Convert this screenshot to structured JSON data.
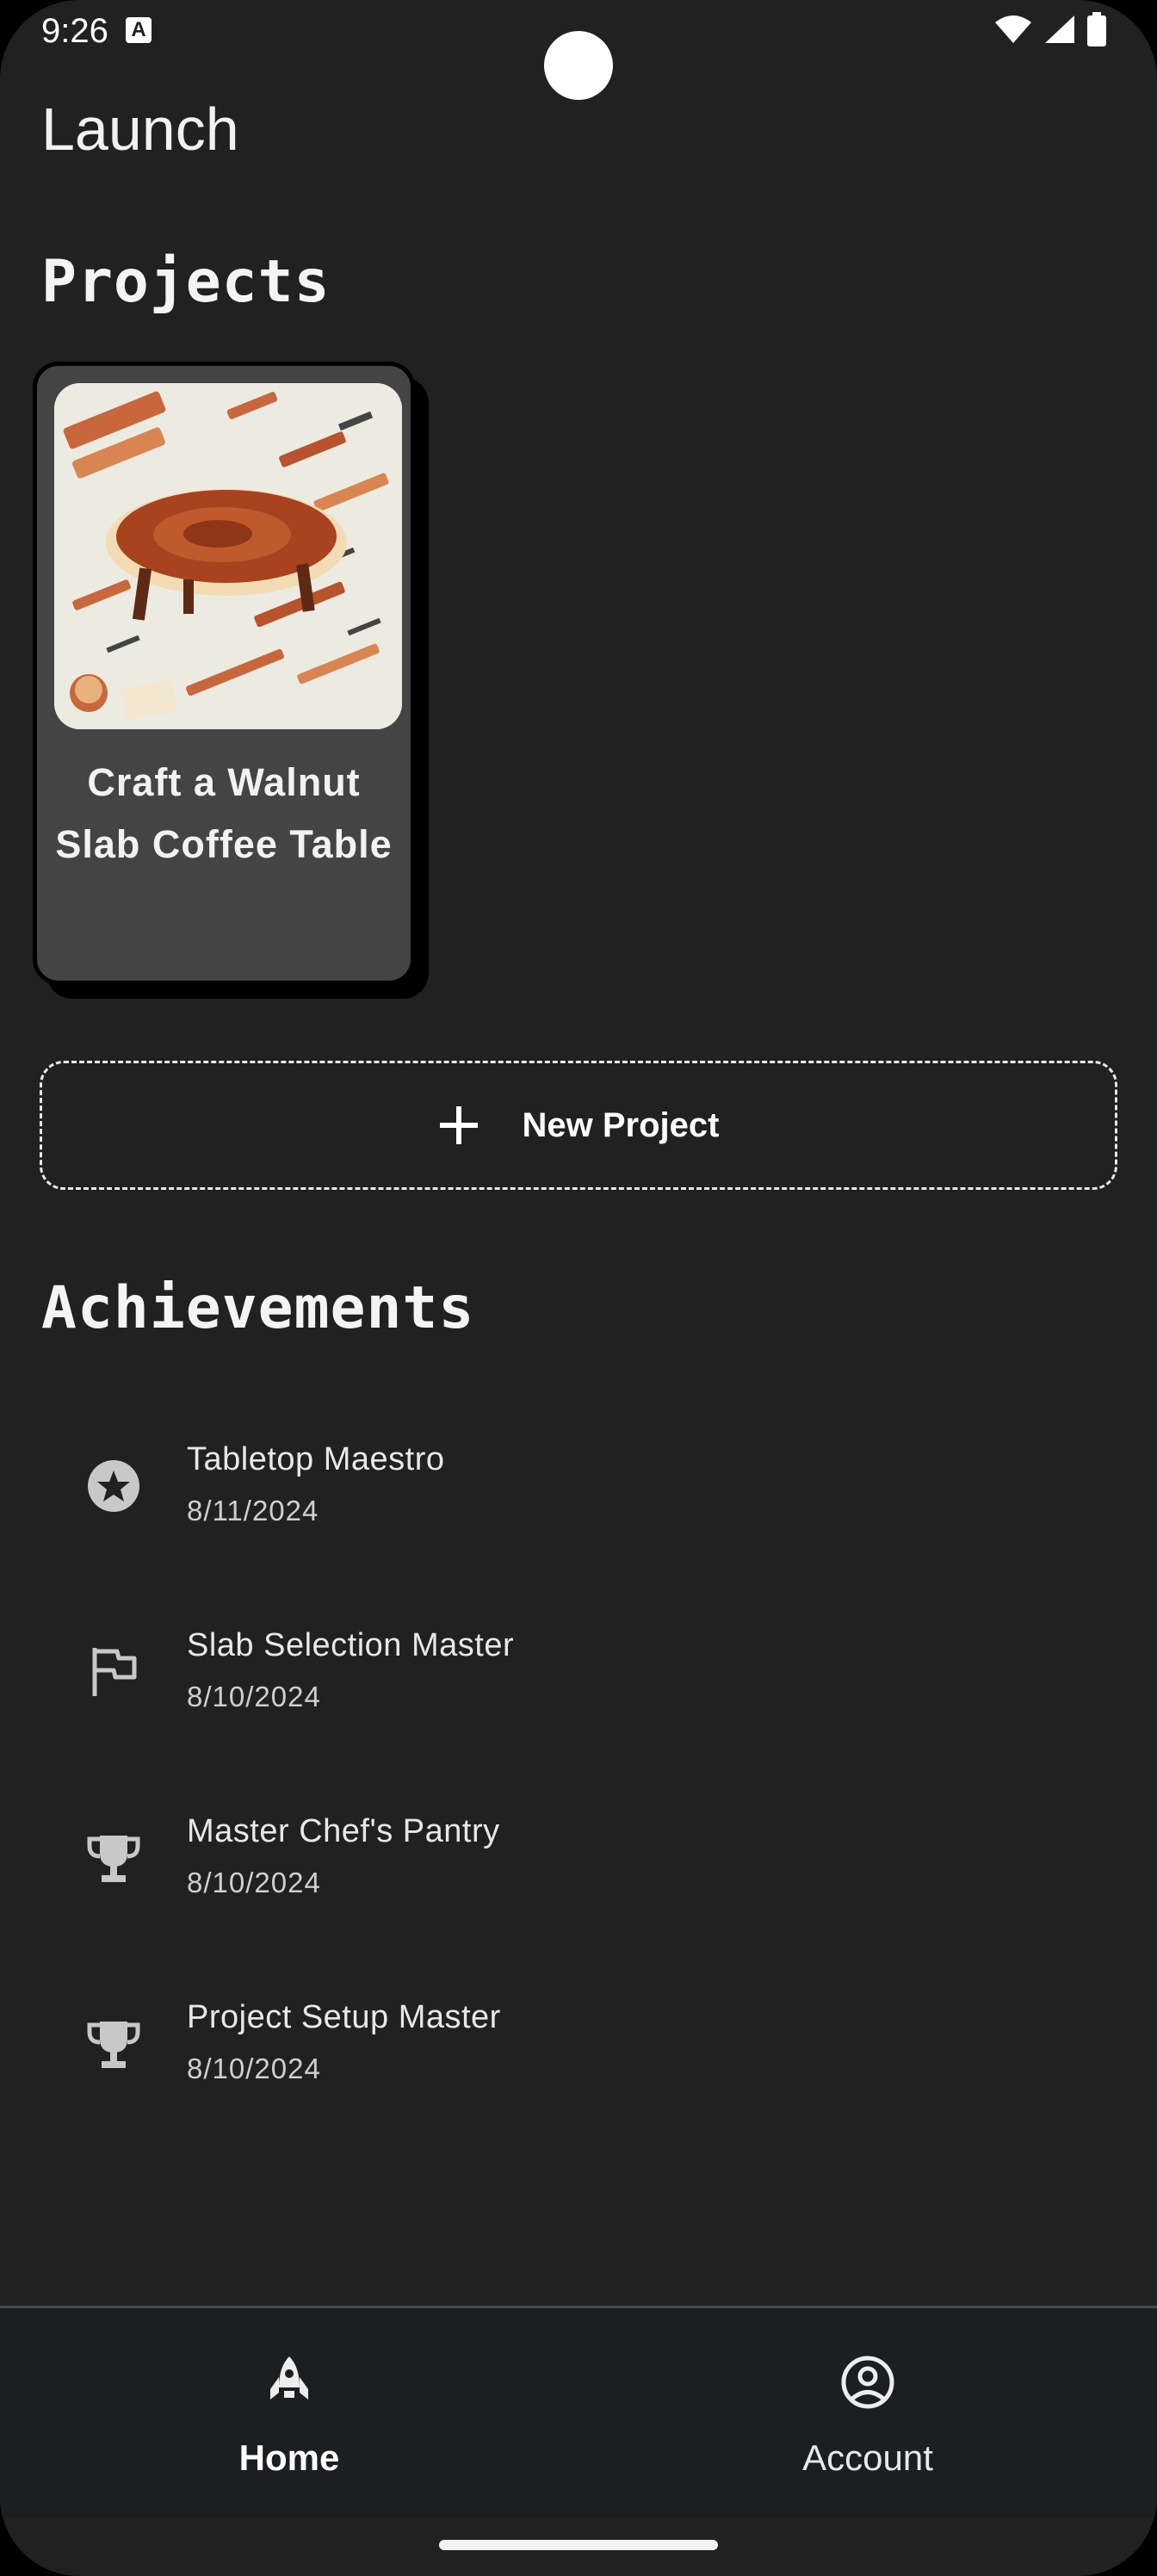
{
  "status_bar": {
    "time": "9:26",
    "badge": "A"
  },
  "app_title": "Launch",
  "projects": {
    "title": "Projects",
    "items": [
      {
        "title": "Craft a Walnut Slab Coffee Table",
        "image": "walnut-table-illustration"
      }
    ],
    "new_project_label": "New Project"
  },
  "achievements": {
    "title": "Achievements",
    "items": [
      {
        "name": "Tabletop Maestro",
        "date": "8/11/2024",
        "icon": "star-circle-icon"
      },
      {
        "name": "Slab Selection Master",
        "date": "8/10/2024",
        "icon": "flag-icon"
      },
      {
        "name": "Master Chef's Pantry",
        "date": "8/10/2024",
        "icon": "trophy-icon"
      },
      {
        "name": "Project Setup Master",
        "date": "8/10/2024",
        "icon": "trophy-icon"
      }
    ]
  },
  "bottom_nav": {
    "items": [
      {
        "label": "Home",
        "icon": "rocket-icon",
        "active": true
      },
      {
        "label": "Account",
        "icon": "account-circle-icon",
        "active": false
      }
    ]
  },
  "colors": {
    "background": "#212122",
    "card": "#444445",
    "nav": "#1c1f22",
    "accent_wood": "#a8502c"
  }
}
